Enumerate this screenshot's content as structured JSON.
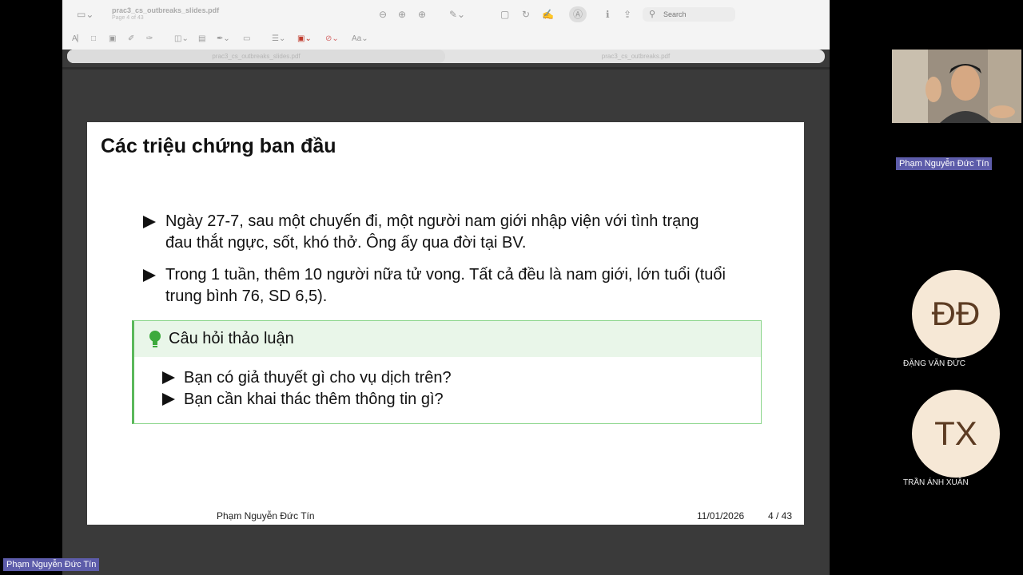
{
  "app": {
    "doc_title": "prac3_cs_outbreaks_slides.pdf",
    "page_info": "Page 4 of 43",
    "search_placeholder": "Search",
    "tabs": [
      "prac3_cs_outbreaks_slides.pdf",
      "prac3_cs_outbreaks.pdf"
    ]
  },
  "slide": {
    "title": "Các triệu chứng ban đầu",
    "bullets": [
      {
        "line1": "Ngày 27-7, sau một chuyến đi, một người nam giới nhập viện với tình trạng",
        "line2": "đau thắt ngực, sốt, khó thở. Ông ấy qua đời tại BV."
      },
      {
        "line1": "Trong 1 tuần, thêm 10 người nữa tử vong. Tất cả đều là nam giới, lớn tuổi (tuổi",
        "line2": "trung bình 76, SD 6,5)."
      }
    ],
    "discussion": {
      "title": "Câu hỏi thảo luận",
      "questions": [
        "Bạn có giả thuyết gì cho vụ dịch trên?",
        "Bạn cần khai thác thêm thông tin gì?"
      ]
    },
    "footer": {
      "author": "Phạm Nguyễn Đức Tín",
      "date": "11/01/2026",
      "page": "4 / 43"
    }
  },
  "participants": {
    "presenter_tag": "Phạm Nguyễn Đức Tín",
    "screen_share_tag": "Phạm Nguyễn Đức Tín",
    "people": [
      {
        "initials": "ĐĐ",
        "name": "ĐẶNG VĂN ĐỨC"
      },
      {
        "initials": "TX",
        "name": "TRẦN ÁNH XUÂN"
      }
    ]
  },
  "colors": {
    "box_border": "#5bb85b",
    "box_head": "#e9f6e9",
    "tag_bg": "#5d5caa",
    "avatar_bg": "#f6e8d6"
  }
}
